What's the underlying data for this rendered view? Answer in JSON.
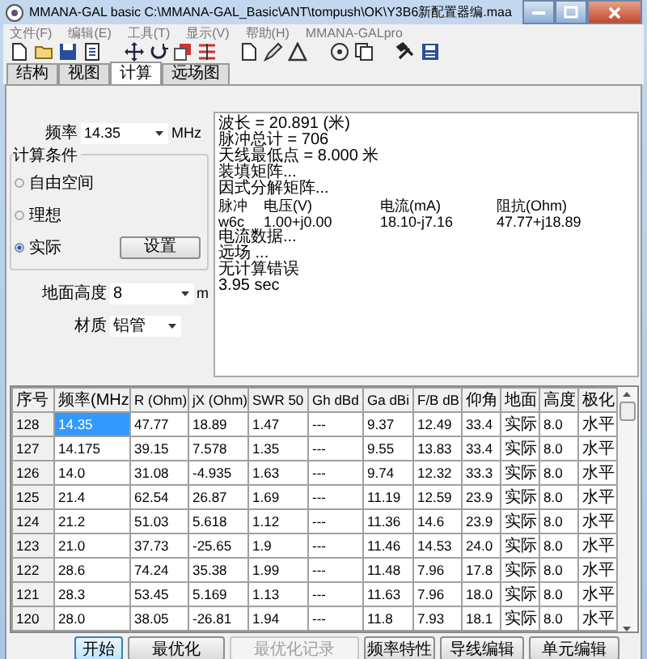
{
  "window": {
    "title": "MMANA-GAL basic C:\\MMANA-GAL_Basic\\ANT\\tompush\\OK\\Y3B6新配置器编.maa"
  },
  "menu": [
    "文件(F)",
    "编辑(E)",
    "工具(T)",
    "显示(V)",
    "帮助(H)",
    "MMANA-GALpro"
  ],
  "tabs": [
    {
      "label": "结构",
      "selected": false
    },
    {
      "label": "视图",
      "selected": false
    },
    {
      "label": "计算",
      "selected": true
    },
    {
      "label": "远场图",
      "selected": false
    }
  ],
  "frequency": {
    "label": "频率",
    "value": "14.35",
    "unit": "MHz"
  },
  "conditions": {
    "title": "计算条件",
    "options": [
      {
        "label": "自由空间",
        "selected": false
      },
      {
        "label": "理想",
        "selected": false
      },
      {
        "label": "实际",
        "selected": true
      }
    ],
    "settings_button": "设置"
  },
  "ground_height": {
    "label": "地面高度",
    "value": "8",
    "unit": "m"
  },
  "material": {
    "label": "材质",
    "value": "铝管"
  },
  "output": {
    "lines_before": [
      "波长 = 20.891 (米)",
      "脉冲总计 = 706",
      "天线最低点 = 8.000 米",
      "装填矩阵...",
      "因式分解矩阵..."
    ],
    "source_columns": [
      "脉冲",
      "电压(V)",
      "电流(mA)",
      "阻抗(Ohm)"
    ],
    "source_rows": [
      [
        "w6c",
        "1.00+j0.00",
        "18.10-j7.16",
        "47.77+j18.89"
      ]
    ],
    "lines_after": [
      "电流数据...",
      "远场 ...",
      "无计算错误",
      "3.95 sec"
    ]
  },
  "table": {
    "columns": [
      "序号",
      "频率(MHz",
      "R (Ohm)",
      "jX (Ohm)",
      "SWR 50",
      "Gh dBd",
      "Ga dBi",
      "F/B dB",
      "仰角",
      "地面",
      "高度",
      "极化"
    ],
    "rows": [
      {
        "selected": true,
        "cells": [
          "128",
          "14.35",
          "47.77",
          "18.89",
          "1.47",
          "---",
          "9.37",
          "12.49",
          "33.4",
          "实际",
          "8.0",
          "水平"
        ]
      },
      {
        "selected": false,
        "cells": [
          "127",
          "14.175",
          "39.15",
          "7.578",
          "1.35",
          "---",
          "9.55",
          "13.83",
          "33.4",
          "实际",
          "8.0",
          "水平"
        ]
      },
      {
        "selected": false,
        "cells": [
          "126",
          "14.0",
          "31.08",
          "-4.935",
          "1.63",
          "---",
          "9.74",
          "12.32",
          "33.3",
          "实际",
          "8.0",
          "水平"
        ]
      },
      {
        "selected": false,
        "cells": [
          "125",
          "21.4",
          "62.54",
          "26.87",
          "1.69",
          "---",
          "11.19",
          "12.59",
          "23.9",
          "实际",
          "8.0",
          "水平"
        ]
      },
      {
        "selected": false,
        "cells": [
          "124",
          "21.2",
          "51.03",
          "5.618",
          "1.12",
          "---",
          "11.36",
          "14.6",
          "23.9",
          "实际",
          "8.0",
          "水平"
        ]
      },
      {
        "selected": false,
        "cells": [
          "123",
          "21.0",
          "37.73",
          "-25.65",
          "1.9",
          "---",
          "11.46",
          "14.53",
          "24.0",
          "实际",
          "8.0",
          "水平"
        ]
      },
      {
        "selected": false,
        "cells": [
          "122",
          "28.6",
          "74.24",
          "35.38",
          "1.99",
          "---",
          "11.48",
          "7.96",
          "17.8",
          "实际",
          "8.0",
          "水平"
        ]
      },
      {
        "selected": false,
        "cells": [
          "121",
          "28.3",
          "53.45",
          "5.169",
          "1.13",
          "---",
          "11.63",
          "7.96",
          "18.0",
          "实际",
          "8.0",
          "水平"
        ]
      },
      {
        "selected": false,
        "cells": [
          "120",
          "28.0",
          "38.05",
          "-26.81",
          "1.94",
          "---",
          "11.8",
          "7.93",
          "18.1",
          "实际",
          "8.0",
          "水平"
        ]
      }
    ]
  },
  "buttons": [
    {
      "label": "开始",
      "default": true,
      "disabled": false
    },
    {
      "label": "最优化",
      "default": false,
      "disabled": false
    },
    {
      "label": "最优化记录",
      "default": false,
      "disabled": true
    },
    {
      "label": "频率特性",
      "default": false,
      "disabled": false
    },
    {
      "label": "导线编辑",
      "default": false,
      "disabled": false
    },
    {
      "label": "单元编辑",
      "default": false,
      "disabled": false
    }
  ]
}
